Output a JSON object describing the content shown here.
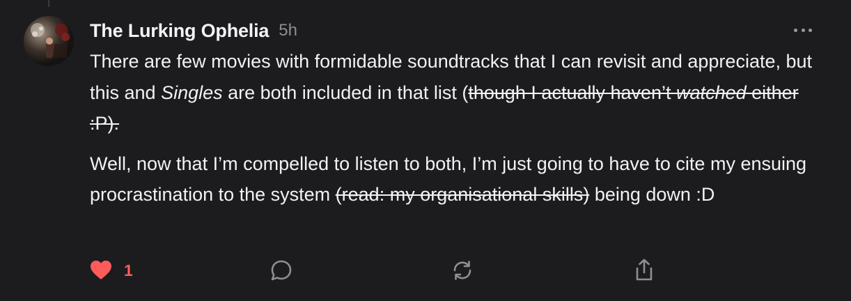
{
  "post": {
    "author": "The Lurking Ophelia",
    "time": "5h",
    "avatar_icon": "profile-photo-icon",
    "paragraphs": [
      {
        "t1": "There are few movies with formidable soundtracks that I can revisit and appreciate, but this and ",
        "t2": "Singles",
        "t3": " are both included in that list (",
        "s1": "though I actually haven’t ",
        "s2": "watched",
        "s3": " either :P)."
      },
      {
        "t1": "Well, now that I’m compelled to listen to both, I’m just going to have to cite my ensuing procrastination to the system ",
        "s1": "(read: my organisational skills)",
        "t2": " being down :D"
      }
    ]
  },
  "actions": {
    "like_count": "1",
    "like_icon": "heart-icon",
    "reply_icon": "reply-icon",
    "repost_icon": "repost-icon",
    "share_icon": "share-icon",
    "more_icon": "more-icon"
  },
  "colors": {
    "background": "#1c1c1e",
    "text": "#f2f2f2",
    "muted": "#8e8e93",
    "like": "#ff5b5b"
  }
}
